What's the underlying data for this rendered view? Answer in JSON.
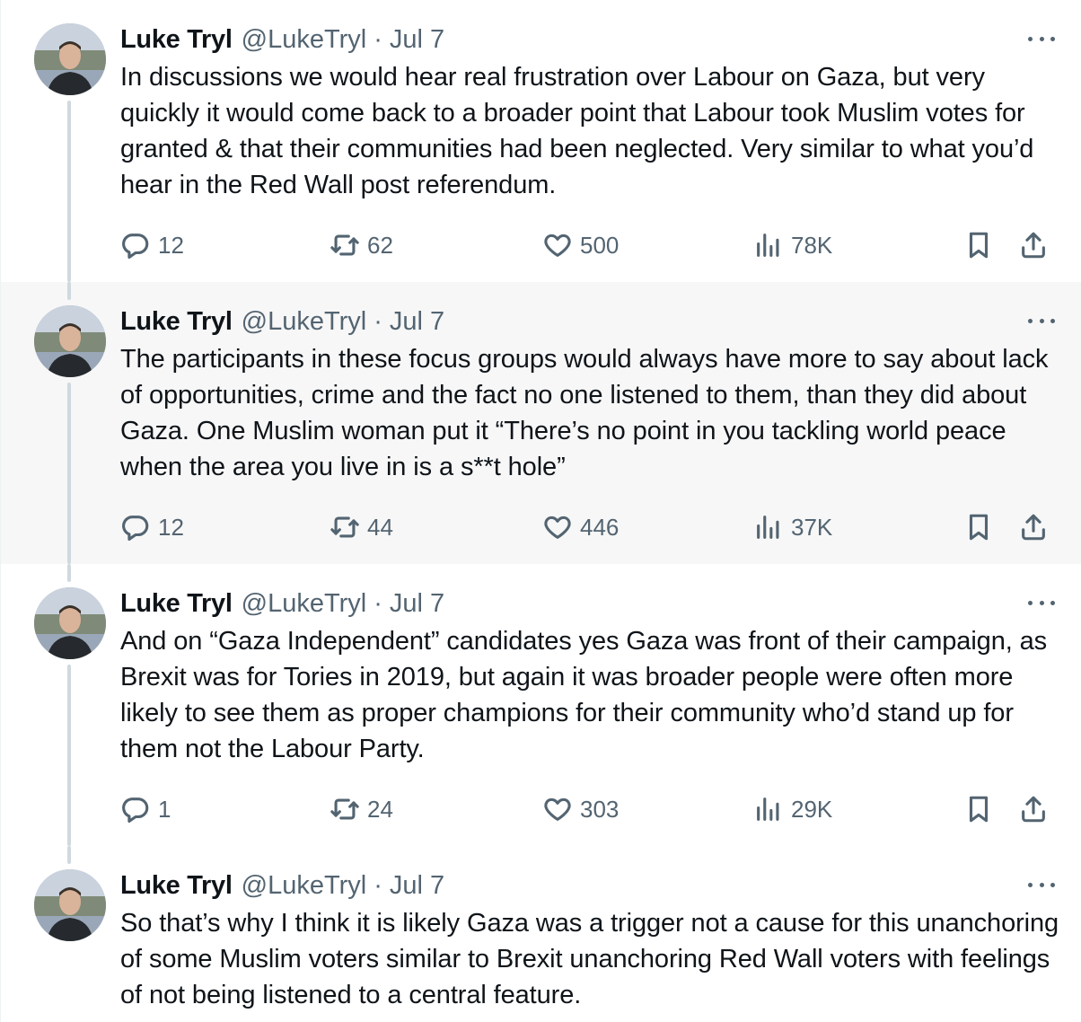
{
  "tweets": [
    {
      "author": "Luke Tryl",
      "handle": "@LukeTryl",
      "separator": "·",
      "date": "Jul 7",
      "text": "In discussions we would hear real frustration over Labour on Gaza, but very quickly it would come back to a broader point that Labour took Muslim votes for granted & that their communities had been neglected. Very similar to what you’d hear in the Red Wall post referendum.",
      "replies": "12",
      "reposts": "62",
      "likes": "500",
      "views": "78K"
    },
    {
      "author": "Luke Tryl",
      "handle": "@LukeTryl",
      "separator": "·",
      "date": "Jul 7",
      "text": "The participants in these focus groups would always have more to say about lack of opportunities, crime and the fact no one listened to them, than they did about Gaza. One Muslim woman put it “There’s no point in you tackling world peace when the area you live in is a s**t hole”",
      "replies": "12",
      "reposts": "44",
      "likes": "446",
      "views": "37K"
    },
    {
      "author": "Luke Tryl",
      "handle": "@LukeTryl",
      "separator": "·",
      "date": "Jul 7",
      "text": "And on “Gaza Independent” candidates yes Gaza was front of their campaign, as Brexit was for Tories in 2019, but again it was broader people were often more likely to see them as proper champions for their community who’d stand up for them not the Labour Party.",
      "replies": "1",
      "reposts": "24",
      "likes": "303",
      "views": "29K"
    },
    {
      "author": "Luke Tryl",
      "handle": "@LukeTryl",
      "separator": "·",
      "date": "Jul 7",
      "text": "So that’s why I think it is likely Gaza was a trigger not a cause for this unanchoring of some Muslim voters similar to Brexit unanchoring Red Wall voters with feelings of not being listened to a central feature."
    }
  ],
  "colors": {
    "text": "#0f1419",
    "secondary": "#536471",
    "thread_line": "#cfd9de",
    "highlight_bg": "#f7f7f7"
  },
  "icons": [
    "reply-icon",
    "repost-icon",
    "like-icon",
    "views-icon",
    "bookmark-icon",
    "share-icon",
    "more-icon"
  ]
}
